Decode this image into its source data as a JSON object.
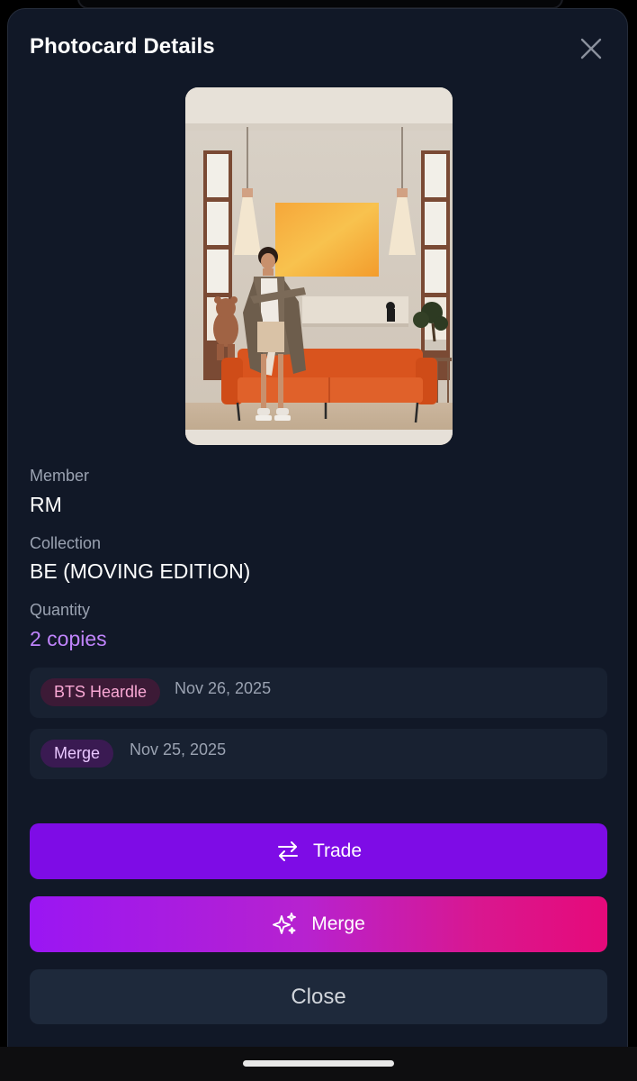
{
  "modal": {
    "title": "Photocard Details",
    "close_icon": "close-icon"
  },
  "photocard": {
    "image": "photocard-image"
  },
  "fields": {
    "member_label": "Member",
    "member_value": "RM",
    "collection_label": "Collection",
    "collection_value": "BE (MOVING EDITION)",
    "quantity_label": "Quantity",
    "quantity_value": "2 copies"
  },
  "history": [
    {
      "source": "BTS Heardle",
      "date": "Nov 26, 2025",
      "tag_color": "#f9a8d4"
    },
    {
      "source": "Merge",
      "date": "Nov 25, 2025",
      "tag_color": "#e9c7ff"
    }
  ],
  "actions": {
    "trade_label": "Trade",
    "trade_icon": "swap-arrows-icon",
    "merge_label": "Merge",
    "merge_icon": "sparkles-icon",
    "close_label": "Close"
  },
  "colors": {
    "background": "#111827",
    "accent": "#c084fc",
    "trade_button": "#7e0ce6",
    "merge_gradient_start": "#9a16f3",
    "merge_gradient_end": "#e60a7a",
    "close_button": "#1e293b"
  }
}
